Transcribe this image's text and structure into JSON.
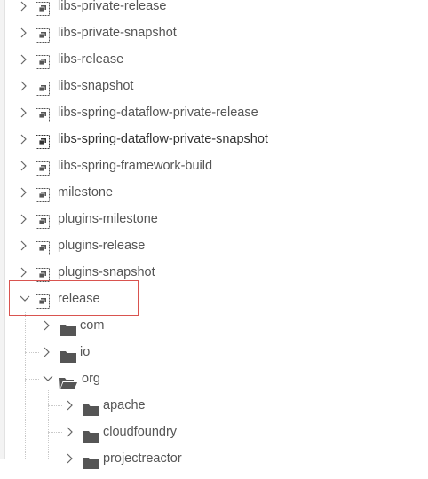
{
  "tree": {
    "repositories": [
      {
        "label": "libs-private-release",
        "expanded": false
      },
      {
        "label": "libs-private-snapshot",
        "expanded": false
      },
      {
        "label": "libs-release",
        "expanded": false
      },
      {
        "label": "libs-snapshot",
        "expanded": false
      },
      {
        "label": "libs-spring-dataflow-private-release",
        "expanded": false
      },
      {
        "label": "libs-spring-dataflow-private-snapshot",
        "expanded": false
      },
      {
        "label": "libs-spring-framework-build",
        "expanded": false
      },
      {
        "label": "milestone",
        "expanded": false
      },
      {
        "label": "plugins-milestone",
        "expanded": false
      },
      {
        "label": "plugins-release",
        "expanded": false
      },
      {
        "label": "plugins-snapshot",
        "expanded": false
      },
      {
        "label": "release",
        "expanded": true
      }
    ],
    "release_children": [
      {
        "label": "com",
        "expanded": false
      },
      {
        "label": "io",
        "expanded": false
      },
      {
        "label": "org",
        "expanded": true
      }
    ],
    "org_children": [
      {
        "label": "apache",
        "expanded": false
      },
      {
        "label": "cloudfoundry",
        "expanded": false
      },
      {
        "label": "projectreactor",
        "expanded": false
      }
    ]
  },
  "colors": {
    "highlight_border": "#d9534f",
    "folder": "#555555",
    "text": "#555555"
  },
  "icons": {
    "repository": "repository-icon",
    "folder_closed": "folder-icon",
    "folder_open": "folder-open-icon",
    "collapsed": "chevron-right-icon",
    "expanded": "chevron-down-icon"
  }
}
